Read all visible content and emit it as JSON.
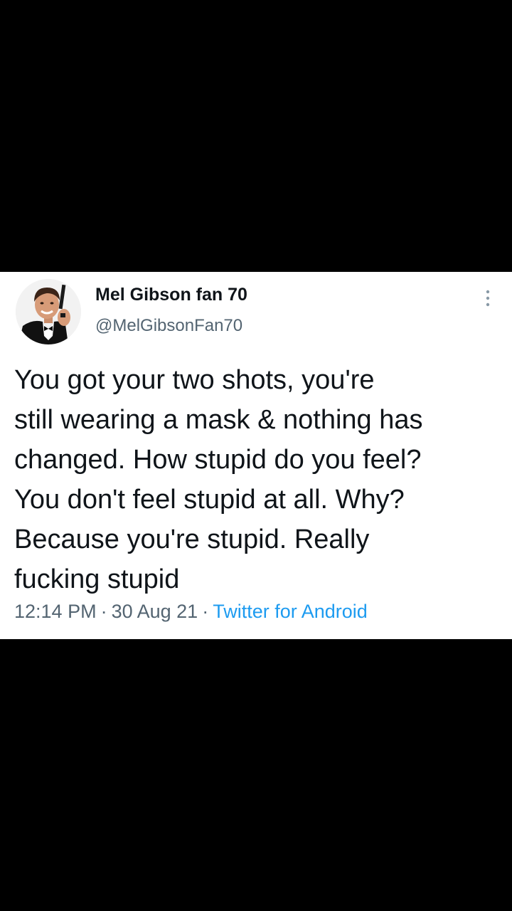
{
  "tweet": {
    "display_name": "Mel Gibson fan 70",
    "handle": "@MelGibsonFan70",
    "text": "You got your two shots, you're\nstill wearing a mask & nothing has\nchanged. How stupid do you feel?\nYou don't feel stupid at all. Why?\nBecause you're stupid. Really\nfucking stupid",
    "time": "12:14 PM",
    "separator": "·",
    "date": "30 Aug 21",
    "source": "Twitter for Android",
    "avatar_icon": "profile-photo-man-in-tuxedo-with-pistol",
    "more_icon": "more-vertical-icon"
  },
  "colors": {
    "background": "#000000",
    "card": "#ffffff",
    "text_primary": "#0f1419",
    "text_secondary": "#536471",
    "link": "#1d9bf0"
  }
}
